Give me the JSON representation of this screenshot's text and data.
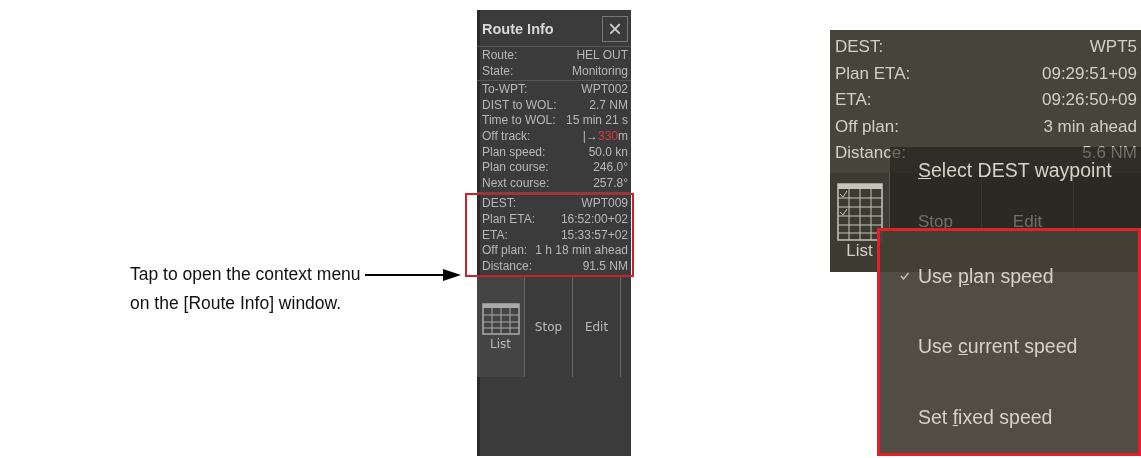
{
  "caption": {
    "lines": [
      "Tap to open the context menu",
      "on the [Route Info] window."
    ]
  },
  "route_info": {
    "title": "Route Info",
    "close": "×",
    "groups": [
      {
        "highlighted": false,
        "rows": [
          {
            "label": "Route:",
            "value": "HEL OUT"
          },
          {
            "label": "State:",
            "value": "Monitoring"
          }
        ]
      },
      {
        "highlighted": false,
        "rows": [
          {
            "label": "To-WPT:",
            "value": "WPT002"
          },
          {
            "label": "DIST to WOL:",
            "value": "2.7 NM"
          },
          {
            "label": "Time to WOL:",
            "value": "15 min 21 s"
          },
          {
            "label": "Off track:",
            "value": "|→",
            "alert_value": "330",
            "unit": "m"
          },
          {
            "label": "Plan speed:",
            "value": "50.0 kn"
          },
          {
            "label": "Plan course:",
            "value": "246.0°"
          },
          {
            "label": "Next course:",
            "value": "257.8°"
          }
        ]
      },
      {
        "highlighted": true,
        "rows": [
          {
            "label": "DEST:",
            "value": "WPT009"
          },
          {
            "label": "Plan ETA:",
            "value": "16:52:00+02"
          },
          {
            "label": "ETA:",
            "value": "15:33:57+02"
          },
          {
            "label": "Off plan:",
            "value": "1 h 18 min ahead"
          },
          {
            "label": "Distance:",
            "value": "91.5 NM"
          }
        ]
      }
    ],
    "buttons": [
      {
        "kind": "list",
        "label": "List"
      },
      {
        "kind": "text",
        "label": "Stop"
      },
      {
        "kind": "text",
        "label": "Edit"
      }
    ]
  },
  "context_view": {
    "rows": [
      {
        "label": "DEST:",
        "value": "WPT5"
      },
      {
        "label": "Plan ETA:",
        "value": "09:29:51+09"
      },
      {
        "label": "ETA:",
        "value": "09:26:50+09"
      },
      {
        "label": "Off plan:",
        "value": "3 min ahead"
      },
      {
        "label": "Distance:",
        "value": "5.6 NM"
      }
    ],
    "buttons": [
      {
        "kind": "list",
        "label": "List"
      },
      {
        "kind": "text",
        "label": "Stop"
      },
      {
        "kind": "text",
        "label": "Edit"
      }
    ],
    "menu": {
      "item": {
        "key": "S",
        "post": "elect DEST waypoint"
      }
    },
    "submenu": {
      "highlighted": true,
      "items": [
        {
          "pre": "Use ",
          "key": "p",
          "post": "lan speed",
          "checked": true
        },
        {
          "pre": "Use ",
          "key": "c",
          "post": "urrent speed",
          "checked": false
        },
        {
          "pre": "Set ",
          "key": "f",
          "post": "ixed speed",
          "checked": false
        }
      ]
    }
  }
}
